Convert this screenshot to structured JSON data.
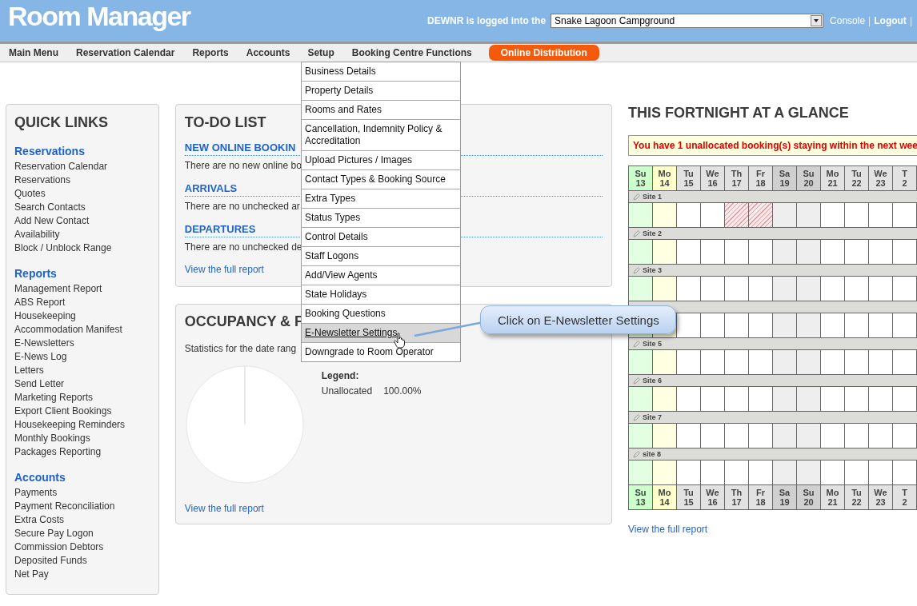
{
  "header": {
    "logo": "Room Manager",
    "login_text": "DEWNR is logged into the",
    "property_select": "Snake Lagoon Campground",
    "links": [
      {
        "kind": "link",
        "label": "Console",
        "bold": false
      },
      {
        "kind": "separator",
        "label": "|",
        "bold": false
      },
      {
        "kind": "link",
        "label": "Logout",
        "bold": true
      },
      {
        "kind": "separator",
        "label": "|",
        "bold": false
      }
    ]
  },
  "nav": [
    {
      "label": "Main Menu",
      "kind": "link"
    },
    {
      "label": "Reservation Calendar",
      "kind": "link"
    },
    {
      "label": "Reports",
      "kind": "link"
    },
    {
      "label": "Accounts",
      "kind": "link"
    },
    {
      "label": "Setup",
      "kind": "link"
    },
    {
      "label": "Booking Centre Functions",
      "kind": "link"
    },
    {
      "label": "Online Distribution",
      "kind": "pill"
    }
  ],
  "setup_menu": [
    {
      "label": "Business Details",
      "hovered": false
    },
    {
      "label": "Property Details",
      "hovered": false
    },
    {
      "label": "Rooms and Rates",
      "hovered": false
    },
    {
      "label": "Cancellation, Indemnity Policy & Accreditation",
      "hovered": false
    },
    {
      "label": "Upload Pictures / Images",
      "hovered": false
    },
    {
      "label": "Contact Types & Booking Source",
      "hovered": false
    },
    {
      "label": "Extra Types",
      "hovered": false
    },
    {
      "label": "Status Types",
      "hovered": false
    },
    {
      "label": "Control Details",
      "hovered": false
    },
    {
      "label": "Staff Logons",
      "hovered": false
    },
    {
      "label": "Add/View Agents",
      "hovered": false
    },
    {
      "label": "State Holidays",
      "hovered": false
    },
    {
      "label": "Booking Questions",
      "hovered": false
    },
    {
      "label": "E-Newsletter Settings",
      "hovered": true
    },
    {
      "label": "Downgrade to Room Operator",
      "hovered": false
    }
  ],
  "quick_links": {
    "title": "QUICK LINKS",
    "sections": [
      {
        "heading": "Reservations",
        "items": [
          "Reservation Calendar",
          "Reservations",
          "Quotes",
          "Search Contacts",
          "Add New Contact",
          "Availability",
          "Block / Unblock Range"
        ]
      },
      {
        "heading": "Reports",
        "items": [
          "Management Report",
          "ABS Report",
          "Housekeeping",
          "Accommodation Manifest",
          "E-Newsletters",
          "E-News Log",
          "Letters",
          "Send Letter",
          "Marketing Reports",
          "Export Client Bookings",
          "Housekeeping Reminders",
          "Monthly Bookings",
          "Packages Reporting"
        ]
      },
      {
        "heading": "Accounts",
        "items": [
          "Payments",
          "Payment Reconciliation",
          "Extra Costs",
          "Secure Pay Logon",
          "Commission Debtors",
          "Deposited Funds",
          "Net Pay"
        ]
      }
    ]
  },
  "todo": {
    "title": "TO-DO LIST",
    "sections": [
      {
        "heading": "NEW ONLINE BOOKIN",
        "text": "There are no new online bo"
      },
      {
        "heading": "ARRIVALS",
        "text": "There are no unchecked ar"
      },
      {
        "heading": "DEPARTURES",
        "text": "There are no unchecked de"
      }
    ],
    "link": "View the full report"
  },
  "occupancy": {
    "title": "OCCUPANCY & F",
    "text": "Statistics for the date rang",
    "legend": {
      "title": "Legend:",
      "rows": [
        {
          "label": "Unallocated",
          "value": "100.00%"
        }
      ]
    },
    "link": "View the full report"
  },
  "glance": {
    "title": "THIS FORTNIGHT AT A GLANCE",
    "alert": "You have **1** unallocated booking(s) staying within the next wee",
    "days": [
      {
        "day": "Su",
        "date": "13",
        "kind": "start"
      },
      {
        "day": "Mo",
        "date": "14",
        "kind": "today"
      },
      {
        "day": "Tu",
        "date": "15",
        "kind": "weekday"
      },
      {
        "day": "We",
        "date": "16",
        "kind": "weekday"
      },
      {
        "day": "Th",
        "date": "17",
        "kind": "weekday"
      },
      {
        "day": "Fr",
        "date": "18",
        "kind": "weekday"
      },
      {
        "day": "Sa",
        "date": "19",
        "kind": "weekend"
      },
      {
        "day": "Su",
        "date": "20",
        "kind": "weekend"
      },
      {
        "day": "Mo",
        "date": "21",
        "kind": "weekday"
      },
      {
        "day": "Tu",
        "date": "22",
        "kind": "weekday"
      },
      {
        "day": "We",
        "date": "23",
        "kind": "weekday"
      },
      {
        "day": "T",
        "date": "2",
        "kind": "weekday"
      }
    ],
    "sites": [
      {
        "label": "Site 1",
        "booked": [
          false,
          false,
          false,
          false,
          true,
          true,
          false,
          false,
          false,
          false,
          false,
          false
        ]
      },
      {
        "label": "Site 2",
        "booked": [
          false,
          false,
          false,
          false,
          false,
          false,
          false,
          false,
          false,
          false,
          false,
          false
        ]
      },
      {
        "label": "Site 3",
        "booked": [
          false,
          false,
          false,
          false,
          false,
          false,
          false,
          false,
          false,
          false,
          false,
          false
        ]
      },
      {
        "booked": [
          false,
          false,
          false,
          false,
          false,
          false,
          false,
          false,
          false,
          false,
          false,
          false
        ]
      },
      {
        "label": "Site 5",
        "booked": [
          false,
          false,
          false,
          false,
          false,
          false,
          false,
          false,
          false,
          false,
          false,
          false
        ]
      },
      {
        "label": "Site 6",
        "booked": [
          false,
          false,
          false,
          false,
          false,
          false,
          false,
          false,
          false,
          false,
          false,
          false
        ]
      },
      {
        "label": "Site 7",
        "booked": [
          false,
          false,
          false,
          false,
          false,
          false,
          false,
          false,
          false,
          false,
          false,
          false
        ]
      },
      {
        "label": "site 8",
        "booked": [
          false,
          false,
          false,
          false,
          false,
          false,
          false,
          false,
          false,
          false,
          false,
          false
        ]
      }
    ],
    "footer_days": [
      {
        "day": "Su",
        "date": "13",
        "kind": "start"
      },
      {
        "day": "Mo",
        "date": "14",
        "kind": "today"
      },
      {
        "day": "Tu",
        "date": "15",
        "kind": "weekday"
      },
      {
        "day": "We",
        "date": "16",
        "kind": "weekday"
      },
      {
        "day": "Th",
        "date": "17",
        "kind": "weekday"
      },
      {
        "day": "Fr",
        "date": "18",
        "kind": "weekday"
      },
      {
        "day": "Sa",
        "date": "19",
        "kind": "weekend"
      },
      {
        "day": "Su",
        "date": "20",
        "kind": "weekend"
      },
      {
        "day": "Mo",
        "date": "21",
        "kind": "weekday"
      },
      {
        "day": "Tu",
        "date": "22",
        "kind": "weekday"
      },
      {
        "day": "We",
        "date": "23",
        "kind": "weekday"
      },
      {
        "day": "T",
        "date": "2",
        "kind": "weekday"
      }
    ],
    "link": "View the full report"
  },
  "callout": {
    "text": "Click on E-Newsletter Settings"
  }
}
